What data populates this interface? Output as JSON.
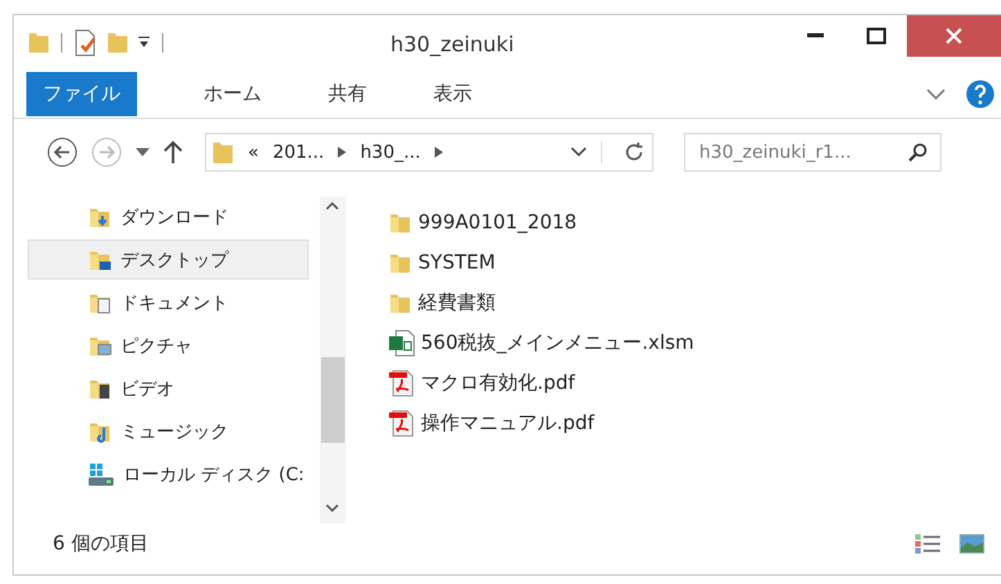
{
  "window": {
    "title": "h30_zeinuki"
  },
  "ribbon_tabs": [
    {
      "label": "ファイル",
      "selected": true
    },
    {
      "label": "ホーム",
      "selected": false
    },
    {
      "label": "共有",
      "selected": false
    },
    {
      "label": "表示",
      "selected": false
    }
  ],
  "address": {
    "segments": [
      "«",
      "201...",
      "h30_..."
    ]
  },
  "search": {
    "placeholder": "h30_zeinuki_r1..."
  },
  "sidebar": {
    "items": [
      {
        "label": "ダウンロード",
        "kind": "download",
        "selected": false
      },
      {
        "label": "デスクトップ",
        "kind": "desktop",
        "selected": true
      },
      {
        "label": "ドキュメント",
        "kind": "documents",
        "selected": false
      },
      {
        "label": "ピクチャ",
        "kind": "pictures",
        "selected": false
      },
      {
        "label": "ビデオ",
        "kind": "videos",
        "selected": false
      },
      {
        "label": "ミュージック",
        "kind": "music",
        "selected": false
      },
      {
        "label": "ローカル ディスク (C:",
        "kind": "drive",
        "selected": false
      }
    ]
  },
  "files": [
    {
      "name": "999A0101_2018",
      "kind": "folder"
    },
    {
      "name": "SYSTEM",
      "kind": "folder"
    },
    {
      "name": "経費書類",
      "kind": "folder"
    },
    {
      "name": "560税抜_メインメニュー.xlsm",
      "kind": "excel"
    },
    {
      "name": "マクロ有効化.pdf",
      "kind": "pdf"
    },
    {
      "name": "操作マニュアル.pdf",
      "kind": "pdf"
    }
  ],
  "status_bar": {
    "count": "6 個の項目"
  }
}
